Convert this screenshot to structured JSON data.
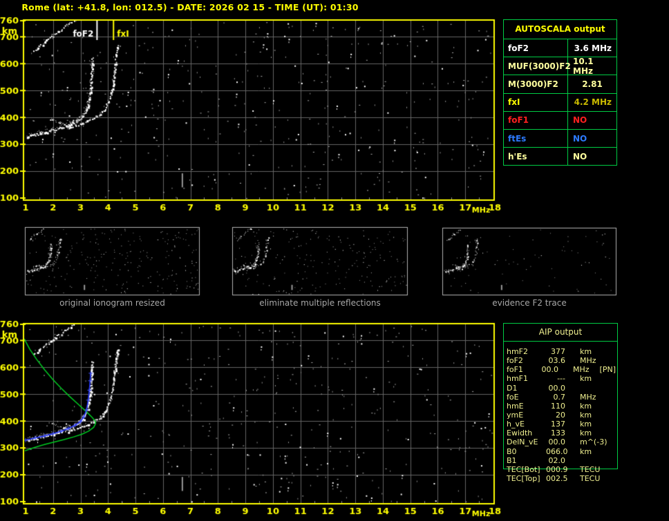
{
  "title": "Rome (lat: +41.8, lon: 012.5) - DATE: 2026 02 15 - TIME (UT): 01:30",
  "captions": [
    "original ionogram resized",
    "eliminate multiple reflections",
    "evidence F2 trace"
  ],
  "autoscala": {
    "header": "AUTOSCALA output",
    "rows": [
      {
        "label": "foF2",
        "value": "3.6 MHz",
        "color": "#ffffff",
        "value_color": "#ffffff",
        "align": "right"
      },
      {
        "label": "MUF(3000)F2",
        "value": "10.1 MHz",
        "color": "#ffffa0",
        "value_color": "#ffffa0",
        "align": "right"
      },
      {
        "label": "M(3000)F2",
        "value": "2.81",
        "color": "#ffff9e",
        "value_color": "#ffff9e",
        "align": "center"
      },
      {
        "label": "fxI",
        "value": "4.2 MHz",
        "color": "#ffff00",
        "value_color": "#c9ba00",
        "align": "right"
      },
      {
        "label": "foF1",
        "value": "NO",
        "color": "#ff2020",
        "value_color": "#ff2020",
        "align": "left"
      },
      {
        "label": "ftEs",
        "value": "NO",
        "color": "#2d7bff",
        "value_color": "#2d7bff",
        "align": "left"
      },
      {
        "label": "h'Es",
        "value": "NO",
        "color": "#ffff9e",
        "value_color": "#ffff9e",
        "align": "left"
      }
    ]
  },
  "aip": {
    "header": "AIP output",
    "rows": [
      {
        "label": "hmF2",
        "value": "377",
        "unit": "km",
        "note": ""
      },
      {
        "label": "foF2",
        "value": "03.6",
        "unit": "MHz",
        "note": ""
      },
      {
        "label": "foF1",
        "value": "00.0",
        "unit": "MHz",
        "note": "[PN]"
      },
      {
        "label": "hmF1",
        "value": "---",
        "unit": "km",
        "note": ""
      },
      {
        "label": "D1",
        "value": "00.0",
        "unit": "",
        "note": ""
      },
      {
        "label": "foE",
        "value": "0.7",
        "unit": "MHz",
        "note": ""
      },
      {
        "label": "hmE",
        "value": "110",
        "unit": "km",
        "note": ""
      },
      {
        "label": "ymE",
        "value": "20",
        "unit": "km",
        "note": ""
      },
      {
        "label": "h_vE",
        "value": "137",
        "unit": "km",
        "note": ""
      },
      {
        "label": "Ewidth",
        "value": "133",
        "unit": "km",
        "note": ""
      },
      {
        "label": "DelN_vE",
        "value": "00.0",
        "unit": "m^(-3)",
        "note": ""
      },
      {
        "label": "B0",
        "value": "066.0",
        "unit": "km",
        "note": ""
      },
      {
        "label": "B1",
        "value": "02.0",
        "unit": "",
        "note": ""
      },
      {
        "label": "TEC[Bot]",
        "value": "000.9",
        "unit": "TECU",
        "note": ""
      },
      {
        "label": "TEC[Top]",
        "value": "002.5",
        "unit": "TECU",
        "note": ""
      }
    ]
  },
  "colors": {
    "accent_yellow": "#ffff00",
    "table_green": "#00cc44",
    "grid_gray": "#666666",
    "caption_gray": "#a8a8a8",
    "aip_text": "#f0f090",
    "profile_green": "#00cc22",
    "fit_blue": "#2233ff",
    "trace_white": "#ffffff",
    "noise_gray": "#909090",
    "thumb_border": "#b4b4b4"
  },
  "chart_data": {
    "type": "scatter",
    "axes": {
      "xlabel": "MHz",
      "ylabel": "km",
      "xrange": [
        1,
        18
      ],
      "yrange": [
        100,
        760
      ],
      "xticks": [
        1,
        2,
        3,
        4,
        5,
        6,
        7,
        8,
        9,
        10,
        11,
        12,
        13,
        14,
        15,
        16,
        17,
        18
      ],
      "yticks": [
        760,
        700,
        600,
        500,
        400,
        300,
        200,
        100
      ],
      "grid": true
    },
    "panels": [
      {
        "id": "main-ionogram",
        "markers": [
          {
            "label": "foF2",
            "f": 3.6,
            "color": "#ffffff"
          },
          {
            "label": "fxI",
            "f": 4.2,
            "color": "#ffff00"
          }
        ]
      },
      {
        "id": "aip-ionogram",
        "has_profiles": true
      },
      {
        "id": "thumb-original"
      },
      {
        "id": "thumb-filtered"
      },
      {
        "id": "thumb-evidence"
      }
    ],
    "traces": {
      "o_trace": [
        [
          1.05,
          330
        ],
        [
          1.35,
          338
        ],
        [
          1.7,
          346
        ],
        [
          2.0,
          354
        ],
        [
          2.3,
          363
        ],
        [
          2.55,
          373
        ],
        [
          2.8,
          385
        ],
        [
          3.0,
          399
        ],
        [
          3.12,
          415
        ],
        [
          3.22,
          437
        ],
        [
          3.3,
          468
        ],
        [
          3.35,
          505
        ],
        [
          3.38,
          548
        ],
        [
          3.4,
          590
        ],
        [
          3.42,
          622
        ]
      ],
      "x_trace": [
        [
          2.55,
          363
        ],
        [
          2.85,
          373
        ],
        [
          3.15,
          384
        ],
        [
          3.45,
          397
        ],
        [
          3.7,
          413
        ],
        [
          3.88,
          433
        ],
        [
          4.0,
          459
        ],
        [
          4.1,
          492
        ],
        [
          4.17,
          530
        ],
        [
          4.22,
          572
        ],
        [
          4.27,
          616
        ],
        [
          4.32,
          655
        ],
        [
          4.35,
          676
        ]
      ],
      "second_hop": [
        [
          1.28,
          648
        ],
        [
          1.55,
          670
        ],
        [
          1.82,
          692
        ],
        [
          2.1,
          714
        ],
        [
          2.38,
          736
        ],
        [
          2.62,
          754
        ],
        [
          2.8,
          768
        ]
      ],
      "cusp_spur": [
        [
          1.95,
          394
        ],
        [
          2.12,
          387
        ],
        [
          2.3,
          379
        ],
        [
          2.48,
          371
        ],
        [
          2.6,
          366
        ]
      ],
      "streak": [
        [
          6.68,
          140
        ],
        [
          6.68,
          192
        ]
      ]
    },
    "profiles": {
      "ne_profile_green": [
        [
          0.95,
          706
        ],
        [
          1.15,
          668
        ],
        [
          1.4,
          630
        ],
        [
          1.7,
          590
        ],
        [
          2.0,
          554
        ],
        [
          2.3,
          522
        ],
        [
          2.6,
          492
        ],
        [
          2.9,
          464
        ],
        [
          3.2,
          436
        ],
        [
          3.42,
          414
        ],
        [
          3.54,
          399
        ],
        [
          3.55,
          391
        ],
        [
          3.48,
          377
        ],
        [
          3.3,
          363
        ],
        [
          3.05,
          351
        ],
        [
          2.75,
          341
        ],
        [
          2.4,
          331
        ],
        [
          2.05,
          322
        ],
        [
          1.7,
          313
        ],
        [
          1.4,
          304
        ],
        [
          1.15,
          296
        ],
        [
          0.97,
          289
        ]
      ],
      "fitted_trace_blue": [
        [
          1.0,
          329
        ],
        [
          1.35,
          337
        ],
        [
          1.7,
          345
        ],
        [
          2.0,
          353
        ],
        [
          2.3,
          362
        ],
        [
          2.55,
          372
        ],
        [
          2.8,
          384
        ],
        [
          3.0,
          398
        ],
        [
          3.12,
          416
        ],
        [
          3.22,
          442
        ],
        [
          3.28,
          478
        ],
        [
          3.32,
          515
        ],
        [
          3.35,
          550
        ],
        [
          3.37,
          578
        ]
      ]
    }
  }
}
